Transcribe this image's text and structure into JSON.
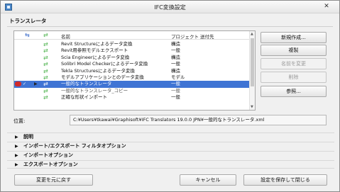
{
  "window": {
    "title": "IFC変換設定",
    "close_glyph": "✕",
    "app_icon": "archicad-app-icon"
  },
  "section_title": "トランスレータ",
  "list": {
    "columns": {
      "name": "名前",
      "project": "プロジェクト",
      "destination": "送付先"
    },
    "rows": [
      {
        "name": "Revit Structureによるデータ変換",
        "project": "構造",
        "selected": false,
        "dim": false
      },
      {
        "name": "Revit用参照モデルエクスポート",
        "project": "一般",
        "selected": false,
        "dim": false
      },
      {
        "name": "Scia Engineerによるデータ変換",
        "project": "構造",
        "selected": false,
        "dim": false
      },
      {
        "name": "Solibri Model Checkerによるデータ変換",
        "project": "一般",
        "selected": false,
        "dim": false
      },
      {
        "name": "Tekla Structuresによるデータ変換",
        "project": "構造",
        "selected": false,
        "dim": false
      },
      {
        "name": "モデルアプリケーションとのデータ変換",
        "project": "モデル",
        "selected": false,
        "dim": false
      },
      {
        "name": "一般的なトランスレータ",
        "project": "一般",
        "selected": true,
        "dim": false
      },
      {
        "name": "一般的なトランスレータ_コピー",
        "project": "一般",
        "selected": false,
        "dim": true
      },
      {
        "name": "正確な形状インポート",
        "project": "一般",
        "selected": false,
        "dim": false
      }
    ],
    "row_marker_glyph": "✓",
    "row_play_glyph": "▶",
    "arrow_glyph": "⇄"
  },
  "buttons": {
    "new": "新規作成...",
    "duplicate": "複製",
    "rename": "名前を変更",
    "delete": "削除",
    "browse": "参照...",
    "revert": "変更を元に戻す",
    "cancel": "キャンセル",
    "save_close": "設定を保存して閉じる"
  },
  "location": {
    "label": "位置:",
    "path": "C:¥Users¥tkawai¥Graphisoft¥IFC Translators 19.0.0 JPN¥一般的なトランスレータ.xml"
  },
  "panels": [
    {
      "label": "説明"
    },
    {
      "label": "インポート/エクスポート フィルタオプション"
    },
    {
      "label": "インポートオプション"
    },
    {
      "label": "エクスポートオプション"
    }
  ],
  "panel_toggle_glyph": "▶"
}
